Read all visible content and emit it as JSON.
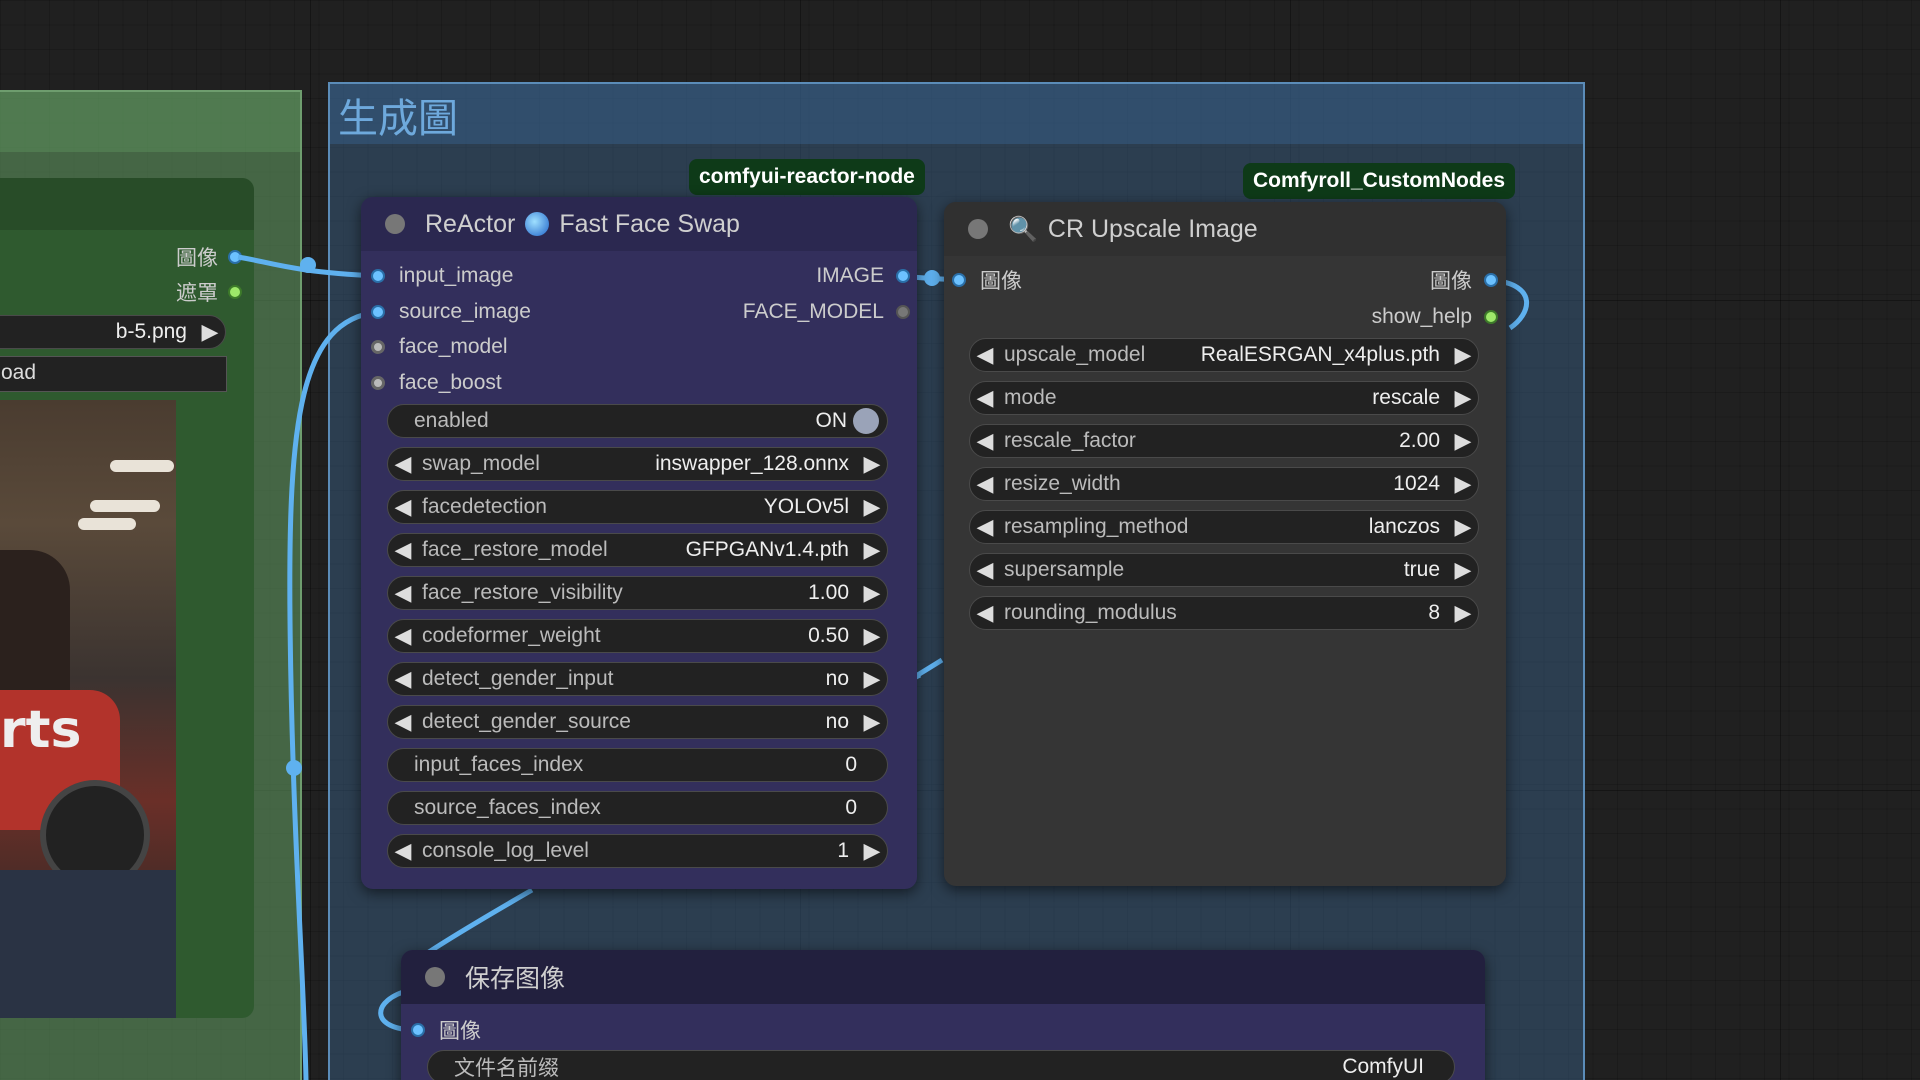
{
  "group_main": {
    "title": "生成圖"
  },
  "badges": {
    "reactor": "comfyui-reactor-node",
    "upscale": "Comfyroll_CustomNodes"
  },
  "load_node": {
    "outputs": [
      {
        "label": "圖像"
      },
      {
        "label": "遮罩"
      }
    ],
    "image_value": "b-5.png",
    "upload_label": "oad"
  },
  "reactor": {
    "title": "ReActor",
    "title_suffix": "Fast Face Swap",
    "inputs": [
      {
        "label": "input_image"
      },
      {
        "label": "source_image"
      },
      {
        "label": "face_model"
      },
      {
        "label": "face_boost"
      }
    ],
    "outputs": [
      {
        "label": "IMAGE"
      },
      {
        "label": "FACE_MODEL"
      }
    ],
    "toggle": {
      "label": "enabled",
      "value": "ON"
    },
    "widgets": [
      {
        "label": "swap_model",
        "value": "inswapper_128.onnx"
      },
      {
        "label": "facedetection",
        "value": "YOLOv5l"
      },
      {
        "label": "face_restore_model",
        "value": "GFPGANv1.4.pth"
      },
      {
        "label": "face_restore_visibility",
        "value": "1.00"
      },
      {
        "label": "codeformer_weight",
        "value": "0.50"
      },
      {
        "label": "detect_gender_input",
        "value": "no"
      },
      {
        "label": "detect_gender_source",
        "value": "no"
      },
      {
        "label": "input_faces_index",
        "value": "0"
      },
      {
        "label": "source_faces_index",
        "value": "0"
      },
      {
        "label": "console_log_level",
        "value": "1"
      }
    ]
  },
  "upscale": {
    "title": "CR Upscale Image",
    "inputs": [
      {
        "label": "圖像"
      }
    ],
    "outputs": [
      {
        "label": "圖像"
      },
      {
        "label": "show_help"
      }
    ],
    "widgets": [
      {
        "label": "upscale_model",
        "value": "RealESRGAN_x4plus.pth"
      },
      {
        "label": "mode",
        "value": "rescale"
      },
      {
        "label": "rescale_factor",
        "value": "2.00"
      },
      {
        "label": "resize_width",
        "value": "1024"
      },
      {
        "label": "resampling_method",
        "value": "lanczos"
      },
      {
        "label": "supersample",
        "value": "true"
      },
      {
        "label": "rounding_modulus",
        "value": "8"
      }
    ]
  },
  "save": {
    "title": "保存图像",
    "inputs": [
      {
        "label": "圖像"
      }
    ],
    "widgets": [
      {
        "label": "文件名前缀",
        "value": "ComfyUI"
      }
    ]
  },
  "photo_text": "rts",
  "colors": {
    "image_link": "#5fb1ef",
    "group_main_title": "#6ea9dc",
    "badge_bg": "#0e3a18"
  }
}
